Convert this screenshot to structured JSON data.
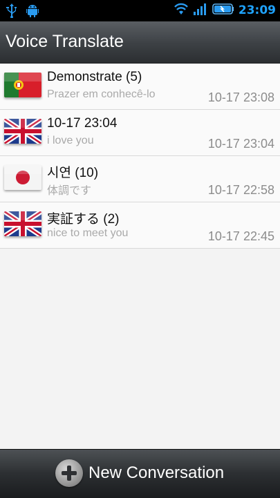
{
  "status_bar": {
    "time": "23:09",
    "icons": [
      "usb-icon",
      "android-debug-icon",
      "wifi-icon",
      "signal-icon",
      "battery-icon"
    ]
  },
  "app": {
    "title": "Voice Translate"
  },
  "conversations": [
    {
      "name": "Demonstrate (5)",
      "subtitle": "Prazer em conhecê-lo",
      "time": "10-17 23:08",
      "flag": "portugal-flag-icon"
    },
    {
      "name": "10-17 23:04",
      "subtitle": "i love you",
      "time": "10-17 23:04",
      "flag": "uk-flag-icon"
    },
    {
      "name": "시연 (10)",
      "subtitle": "体調です",
      "time": "10-17 22:58",
      "flag": "japan-flag-icon"
    },
    {
      "name": "実証する (2)",
      "subtitle": "nice to meet you",
      "time": "10-17 22:45",
      "flag": "uk-flag-icon"
    }
  ],
  "bottom_bar": {
    "new_conversation_label": "New Conversation"
  },
  "colors": {
    "time_accent": "#1fa3ff",
    "list_bg": "#f3f3f3",
    "subtitle": "#a9a9a9"
  }
}
